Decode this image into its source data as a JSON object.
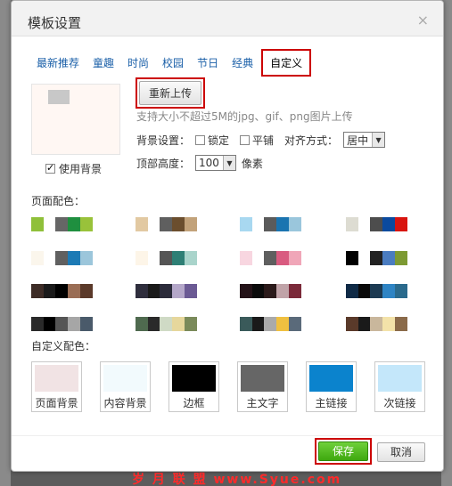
{
  "dialog": {
    "title": "模板设置",
    "close_glyph": "×"
  },
  "tabs": [
    "最新推荐",
    "童趣",
    "时尚",
    "校园",
    "节日",
    "经典",
    "自定义"
  ],
  "upload": {
    "reupload_label": "重新上传",
    "hint": "支持大小不超过5M的jpg、gif、png图片上传",
    "use_bg_label": "使用背景",
    "bg_setting_label": "背景设置：",
    "lock_label": "锁定",
    "tile_label": "平铺",
    "align_label": "对齐方式：",
    "align_value": "居中",
    "top_height_label": "顶部高度：",
    "top_height_value": "100",
    "unit_label": "像素"
  },
  "palettes_label": "页面配色：",
  "palettes": [
    [
      "#8fc03a",
      "#ffffff",
      "#666666",
      "#1f8f3f",
      "#99c23a"
    ],
    [
      "#e2c9a2",
      "#ffffff",
      "#5f5f5f",
      "#6b4e2e",
      "#c2a27a"
    ],
    [
      "#a8d8f0",
      "#ffffff",
      "#5b5b5b",
      "#1a74b0",
      "#9ac6dc"
    ],
    [
      "#dddcd2",
      "#ffffff",
      "#4d4d4d",
      "#0b4a9e",
      "#d8140f"
    ],
    [
      "#fbf6ec",
      "#ffffff",
      "#606060",
      "#1c7ab5",
      "#9cc6db"
    ],
    [
      "#fdf5e8",
      "#ffffff",
      "#555555",
      "#2e7f75",
      "#a9d4cb"
    ],
    [
      "#f8d6e0",
      "#ffffff",
      "#5f5f5f",
      "#d95b80",
      "#f0a6b8"
    ],
    [
      "#000000",
      "#ffffff",
      "#222222",
      "#4a7cc0",
      "#7d9a33"
    ],
    [
      "#3d2c26",
      "#1a1a1a",
      "#000000",
      "#9a6d55",
      "#5b3a2a"
    ],
    [
      "#2f2e3d",
      "#1a1a1a",
      "#2b2b3a",
      "#b4a7c9",
      "#6b5a94"
    ],
    [
      "#241318",
      "#0b0b0b",
      "#2b1a1a",
      "#c0a3a8",
      "#7b2a3a"
    ],
    [
      "#0f2a46",
      "#0a0a0a",
      "#1c3a52",
      "#2e84c4",
      "#2a6a8c"
    ],
    [
      "#2a2a2a",
      "#000000",
      "#555555",
      "#a6a6a6",
      "#4a5a6a"
    ],
    [
      "#4f6a4f",
      "#2a2a2a",
      "#cfdac5",
      "#e6d79c",
      "#7a8a5a"
    ],
    [
      "#3a5a5a",
      "#1a1a1a",
      "#aaaaaa",
      "#f0c040",
      "#5a6a7a"
    ],
    [
      "#5a3a2a",
      "#1a1a1a",
      "#c9b79c",
      "#f3e2a9",
      "#8a6a4a"
    ]
  ],
  "custom_label": "自定义配色：",
  "custom": [
    {
      "label": "页面背景",
      "color": "#f1e3e4"
    },
    {
      "label": "内容背景",
      "color": "#f2fafd"
    },
    {
      "label": "边框",
      "color": "#000000"
    },
    {
      "label": "主文字",
      "color": "#666666"
    },
    {
      "label": "主链接",
      "color": "#0b83cd"
    },
    {
      "label": "次链接",
      "color": "#c4e7fa"
    }
  ],
  "footer": {
    "save_label": "保存",
    "cancel_label": "取消"
  },
  "watermark": "岁 月 联 盟 www.Syue.com"
}
